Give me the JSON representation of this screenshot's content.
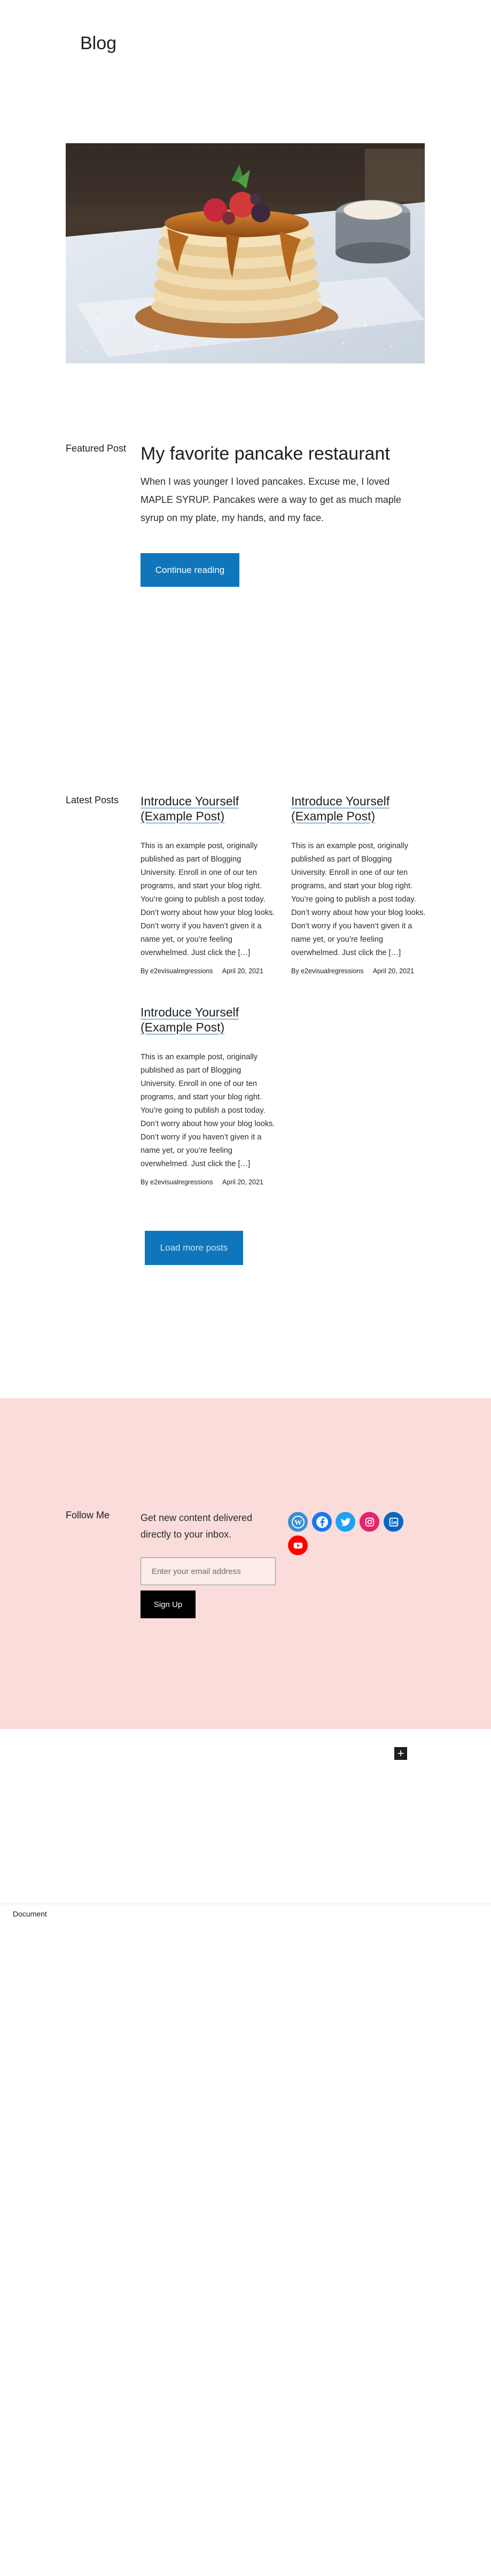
{
  "header": {
    "site_title": "Blog"
  },
  "hero": {
    "image_alt": "Stack of pancakes with syrup and berries"
  },
  "featured": {
    "label": "Featured Post",
    "title": "My favorite pancake restaurant",
    "excerpt": "When I was younger I loved pancakes. Excuse me, I loved MAPLE SYRUP. Pancakes were a way to get as much maple syrup on my plate, my hands, and my face.",
    "button_label": "Continue reading"
  },
  "latest": {
    "label": "Latest Posts",
    "posts": [
      {
        "title": "Introduce Yourself (Example Post)",
        "excerpt": "This is an example post, originally published as part of Blogging University. Enroll in one of our ten programs, and start your blog right. You’re going to publish a post today. Don’t worry about how your blog looks. Don’t worry if you haven’t given it a name yet, or you’re feeling overwhelmed. Just click the […]",
        "author": "By e2evisualregressions",
        "date": "April 20, 2021"
      },
      {
        "title": "Introduce Yourself (Example Post)",
        "excerpt": "This is an example post, originally published as part of Blogging University. Enroll in one of our ten programs, and start your blog right. You’re going to publish a post today. Don’t worry about how your blog looks. Don’t worry if you haven’t given it a name yet, or you’re feeling overwhelmed. Just click the […]",
        "author": "By e2evisualregressions",
        "date": "April 20, 2021"
      },
      {
        "title": "Introduce Yourself (Example Post)",
        "excerpt": "This is an example post, originally published as part of Blogging University. Enroll in one of our ten programs, and start your blog right. You’re going to publish a post today. Don’t worry about how your blog looks. Don’t worry if you haven’t given it a name yet, or you’re feeling overwhelmed. Just click the […]",
        "author": "By e2evisualregressions",
        "date": "April 20, 2021"
      }
    ],
    "load_more_label": "Load more posts"
  },
  "newsletter": {
    "label": "Follow Me",
    "text": "Get new content delivered directly to your inbox.",
    "email_placeholder": "Enter your email address",
    "signup_label": "Sign Up",
    "social_icons": [
      {
        "name": "wordpress-icon",
        "color": "#3a8fd6"
      },
      {
        "name": "facebook-icon",
        "color": "#1977f3"
      },
      {
        "name": "twitter-icon",
        "color": "#1da1f2"
      },
      {
        "name": "instagram-icon",
        "color": "#e4246f"
      },
      {
        "name": "linkedin-icon",
        "color": "#0a66c2"
      },
      {
        "name": "youtube-icon",
        "color": "#ff0000"
      }
    ]
  },
  "editor": {
    "add_block_label": "+"
  },
  "footer": {
    "breadcrumb": "Document"
  },
  "colors": {
    "accent": "#0f76bc",
    "band": "#fadcda",
    "signup": "#000000"
  }
}
